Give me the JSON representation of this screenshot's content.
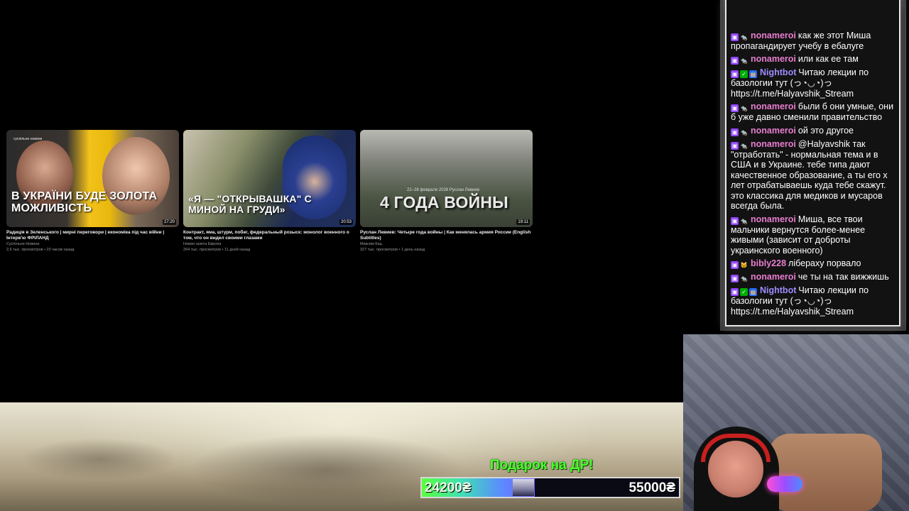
{
  "videos": [
    {
      "thumb_text": "В УКРАЇНИ БУДЕ ЗОЛОТА МОЖЛИВІСТЬ",
      "brand": "суспільне новини",
      "duration": "27:20",
      "title": "Радиція в Зеленського | мирні переговори | економіка під час війни | Інтерв'ю ФРІЛАНД",
      "channel": "Суспільне Новини",
      "stats": "2,6 тыс. просмотров • 20 часов назад"
    },
    {
      "thumb_text": "«Я — \"ОТКРЫВАШКА\" С МИНОЙ НА ГРУДИ»",
      "duration": "20:53",
      "title": "Контракт, яма, штурм, побег, федеральный розыск: монолог военного о том, что он видел своими глазами",
      "channel": "Новая газета Европа",
      "stats": "264 тыс. просмотров • 11 дней назад"
    },
    {
      "thumb_text": "4 ГОДА ВОЙНЫ",
      "thumb_sub": "22–28 февраля 2026   Руслан Левиев",
      "duration": "19:11",
      "title": "Руслан Левиев: Четыре года войны | Как менялась армия России (English Subtitles)",
      "channel": "Максим Кац",
      "stats": "327 тыс. просмотров • 1 день назад"
    }
  ],
  "chat": [
    {
      "user": "nonameroi",
      "color": "pink",
      "badges": [
        "twitch",
        "rat"
      ],
      "text": "как же этот Миша пропагандирует учебу в ебалуге"
    },
    {
      "user": "nonameroi",
      "color": "pink",
      "badges": [
        "twitch",
        "rat"
      ],
      "text": "или как ее там"
    },
    {
      "user": "Nightbot",
      "color": "purple",
      "badges": [
        "twitch",
        "check",
        "bot"
      ],
      "text": "Читаю лекции по базологии тут (っ◔◡◔)っ https://t.me/Halyavshik_Stream"
    },
    {
      "user": "nonameroi",
      "color": "pink",
      "badges": [
        "twitch",
        "rat"
      ],
      "text": "были б они умные, они б уже давно сменили правительство"
    },
    {
      "user": "nonameroi",
      "color": "pink",
      "badges": [
        "twitch",
        "rat"
      ],
      "text": "ой это другое"
    },
    {
      "user": "nonameroi",
      "color": "pink",
      "badges": [
        "twitch",
        "rat"
      ],
      "text": "@Halyavshik так \"отработать\" - нормальная тема и в США и в Украине. тебе типа дают качественное образование, а ты его х лет отрабатываешь куда тебе скажут. это классика для медиков и мусаров всегда была."
    },
    {
      "user": "nonameroi",
      "color": "pink",
      "badges": [
        "twitch",
        "rat"
      ],
      "text": "Миша, все твои мальчики вернутся более-менее живыми (зависит от доброты украинского военного)"
    },
    {
      "user": "bibly228",
      "color": "pink",
      "badges": [
        "twitch",
        "cat"
      ],
      "text": "лібераху порвало"
    },
    {
      "user": "nonameroi",
      "color": "pink",
      "badges": [
        "twitch",
        "rat"
      ],
      "text": "че ты на так вижжишь"
    },
    {
      "user": "Nightbot",
      "color": "purple",
      "badges": [
        "twitch",
        "check",
        "bot"
      ],
      "text": "Читаю лекции по базологии тут (っ◔◡◔)っ https://t.me/Halyavshik_Stream"
    }
  ],
  "goal": {
    "title": "Подарок на ДР!",
    "current": "24200₴",
    "target": "55000₴",
    "progress": 0.44
  }
}
